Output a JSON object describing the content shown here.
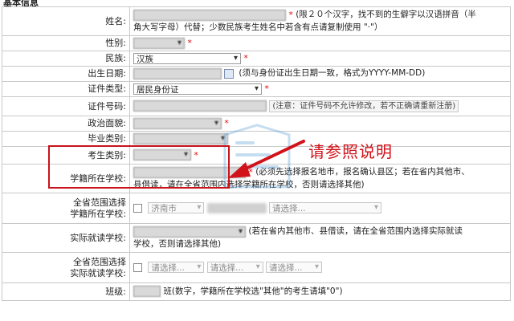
{
  "section_title": "基本信息",
  "fields": {
    "name": {
      "label": "姓名:",
      "hint_line1": "(限２０个汉字，找不到的生僻字以汉语拼音（半",
      "hint_line2": "角大写字母）代替；少数民族考生姓名中若含有点请复制使用 \"·\"）"
    },
    "gender": {
      "label": "性别:"
    },
    "ethnicity": {
      "label": "民族:",
      "value": "汉族"
    },
    "birth_date": {
      "label": "出生日期:",
      "hint": "(须与身份证出生日期一致，格式为YYYY-MM-DD)"
    },
    "id_type": {
      "label": "证件类型:",
      "value": "居民身份证"
    },
    "id_number": {
      "label": "证件号码:",
      "hint": "(注意：证件号码不允许修改，若不正确请重新注册)"
    },
    "political": {
      "label": "政治面貌:"
    },
    "graduation_type": {
      "label": "毕业类别:"
    },
    "candidate_type": {
      "label": "考生类别:"
    },
    "registered_school": {
      "label": "学籍所在学校:",
      "hint_line1": "(必须先选择报名地市，报名确认县区；若在省内其他市、",
      "hint_line2": "县借读，请在全省范围内选择学籍所在学校，否则请选择其他)"
    },
    "province_school_1": {
      "label_line1": "全省范围选择",
      "label_line2": "学籍所在学校:",
      "city": "济南市",
      "placeholder": "请选择..."
    },
    "actual_school": {
      "label": "实际就读学校:",
      "hint_line1": "(若在省内其他市、县借读，请在全省范围内选择实际就读",
      "hint_line2": "学校，否则请选择其他)"
    },
    "province_school_2": {
      "label_line1": "全省范围选择",
      "label_line2": "实际就读学校:",
      "placeholder": "请选择..."
    },
    "class_no": {
      "label": "班级:",
      "unit": "班",
      "hint": "(数字，学籍所在学校选\"其他\"的考生请填\"0\")"
    }
  },
  "required_mark": "*",
  "annotation_text": "请参照说明",
  "colors": {
    "required": "#e01010",
    "annotation": "#d1121a",
    "border": "#c8c8c8"
  }
}
